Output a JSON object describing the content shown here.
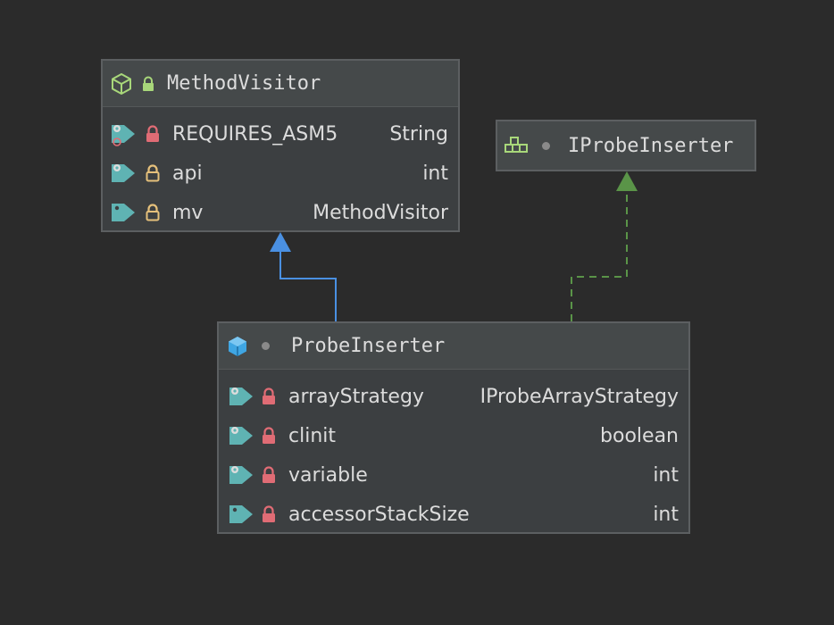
{
  "classes": {
    "method_visitor": {
      "title": "MethodVisitor",
      "fields": [
        {
          "name": "REQUIRES_ASM5",
          "type": "String"
        },
        {
          "name": "api",
          "type": "int"
        },
        {
          "name": "mv",
          "type": "MethodVisitor"
        }
      ]
    },
    "iprobe_inserter": {
      "title": "IProbeInserter"
    },
    "probe_inserter": {
      "title": "ProbeInserter",
      "fields": [
        {
          "name": "arrayStrategy",
          "type": "IProbeArrayStrategy"
        },
        {
          "name": "clinit",
          "type": "boolean"
        },
        {
          "name": "variable",
          "type": "int"
        },
        {
          "name": "accessorStackSize",
          "type": "int"
        }
      ]
    }
  },
  "colors": {
    "background": "#2b2b2b",
    "inheritance_edge": "#4a90e2",
    "implements_edge": "#5a9448",
    "lock_private": "#e06c75",
    "lock_protected": "#e5c07b",
    "field_tag": "#5fb3b3",
    "class_icon_abstract": "#a8d77a",
    "class_icon": "#3fa6e3"
  }
}
